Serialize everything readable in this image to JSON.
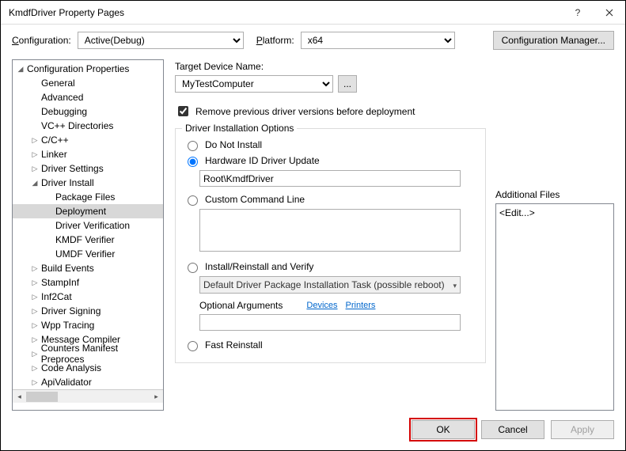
{
  "window": {
    "title": "KmdfDriver Property Pages"
  },
  "configBar": {
    "configLabel": "Configuration:",
    "configValue": "Active(Debug)",
    "platformLabel": "Platform:",
    "platformValue": "x64",
    "managerBtn": "Configuration Manager..."
  },
  "tree": {
    "root": "Configuration Properties",
    "items": [
      {
        "label": "General",
        "indent": 1,
        "arrow": ""
      },
      {
        "label": "Advanced",
        "indent": 1,
        "arrow": ""
      },
      {
        "label": "Debugging",
        "indent": 1,
        "arrow": ""
      },
      {
        "label": "VC++ Directories",
        "indent": 1,
        "arrow": ""
      },
      {
        "label": "C/C++",
        "indent": 1,
        "arrow": "▷"
      },
      {
        "label": "Linker",
        "indent": 1,
        "arrow": "▷"
      },
      {
        "label": "Driver Settings",
        "indent": 1,
        "arrow": "▷"
      },
      {
        "label": "Driver Install",
        "indent": 1,
        "arrow": "◢"
      },
      {
        "label": "Package Files",
        "indent": 2,
        "arrow": ""
      },
      {
        "label": "Deployment",
        "indent": 2,
        "arrow": "",
        "selected": true
      },
      {
        "label": "Driver Verification",
        "indent": 2,
        "arrow": ""
      },
      {
        "label": "KMDF Verifier",
        "indent": 2,
        "arrow": ""
      },
      {
        "label": "UMDF Verifier",
        "indent": 2,
        "arrow": ""
      },
      {
        "label": "Build Events",
        "indent": 1,
        "arrow": "▷"
      },
      {
        "label": "StampInf",
        "indent": 1,
        "arrow": "▷"
      },
      {
        "label": "Inf2Cat",
        "indent": 1,
        "arrow": "▷"
      },
      {
        "label": "Driver Signing",
        "indent": 1,
        "arrow": "▷"
      },
      {
        "label": "Wpp Tracing",
        "indent": 1,
        "arrow": "▷"
      },
      {
        "label": "Message Compiler",
        "indent": 1,
        "arrow": "▷"
      },
      {
        "label": "Counters Manifest Preproces",
        "indent": 1,
        "arrow": "▷"
      },
      {
        "label": "Code Analysis",
        "indent": 1,
        "arrow": "▷"
      },
      {
        "label": "ApiValidator",
        "indent": 1,
        "arrow": "▷"
      }
    ]
  },
  "main": {
    "targetDeviceLabel": "Target Device Name:",
    "targetDeviceValue": "MyTestComputer",
    "browseBtn": "...",
    "removePrevLabel": "Remove previous driver versions before deployment",
    "removePrevChecked": true,
    "installGroup": "Driver Installation Options",
    "radios": {
      "doNotInstall": "Do Not Install",
      "hwId": "Hardware ID Driver Update",
      "hwIdValue": "Root\\KmdfDriver",
      "custom": "Custom Command Line",
      "customValue": "",
      "installVerify": "Install/Reinstall and Verify",
      "taskValue": "Default Driver Package Installation Task (possible reboot)",
      "optArgsLabel": "Optional Arguments",
      "devicesLink": "Devices",
      "printersLink": "Printers",
      "optArgsValue": "",
      "fastReinstall": "Fast Reinstall",
      "selected": "hwId"
    },
    "additionalFilesLabel": "Additional Files",
    "additionalFilesValue": "<Edit...>"
  },
  "footer": {
    "ok": "OK",
    "cancel": "Cancel",
    "apply": "Apply"
  }
}
